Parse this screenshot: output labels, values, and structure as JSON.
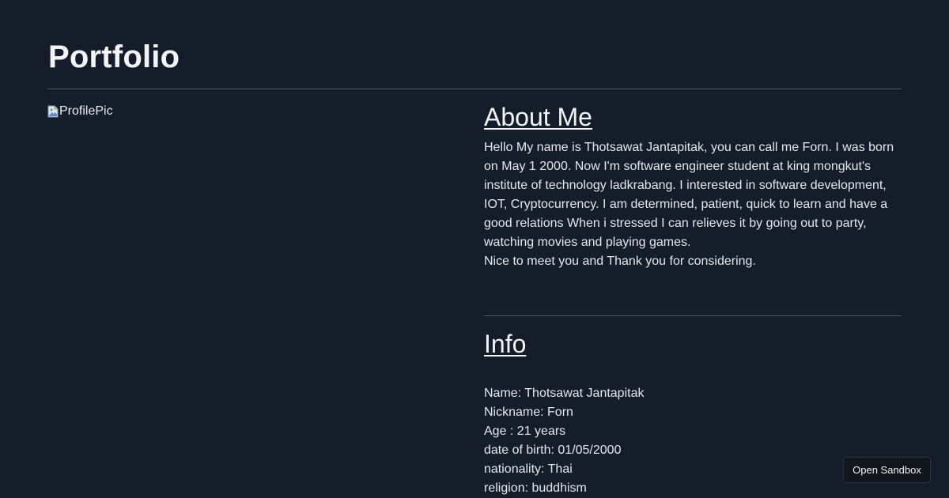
{
  "page": {
    "title": "Portfolio",
    "background_color": "#151d2b"
  },
  "profile": {
    "image_alt": "ProfilePic",
    "icon": "broken-image-icon"
  },
  "about": {
    "heading": "About Me",
    "paragraph": "Hello My name is Thotsawat Jantapitak, you can call me Forn. I was born on May 1 2000. Now I'm software engineer student at king mongkut's institute of technology ladkrabang. I interested in software development, IOT, Cryptocurrency. I am determined, patient, quick to learn and have a good relations When i stressed I can relieves it by going out to party, watching movies and playing games.",
    "closing": "Nice to meet you and Thank you for considering."
  },
  "info": {
    "heading": "Info",
    "items": [
      "Name: Thotsawat Jantapitak",
      "Nickname: Forn",
      "Age : 21 years",
      "date of birth: 01/05/2000",
      "nationality: Thai",
      "religion: buddhism"
    ]
  },
  "sandbox": {
    "label": "Open Sandbox"
  }
}
